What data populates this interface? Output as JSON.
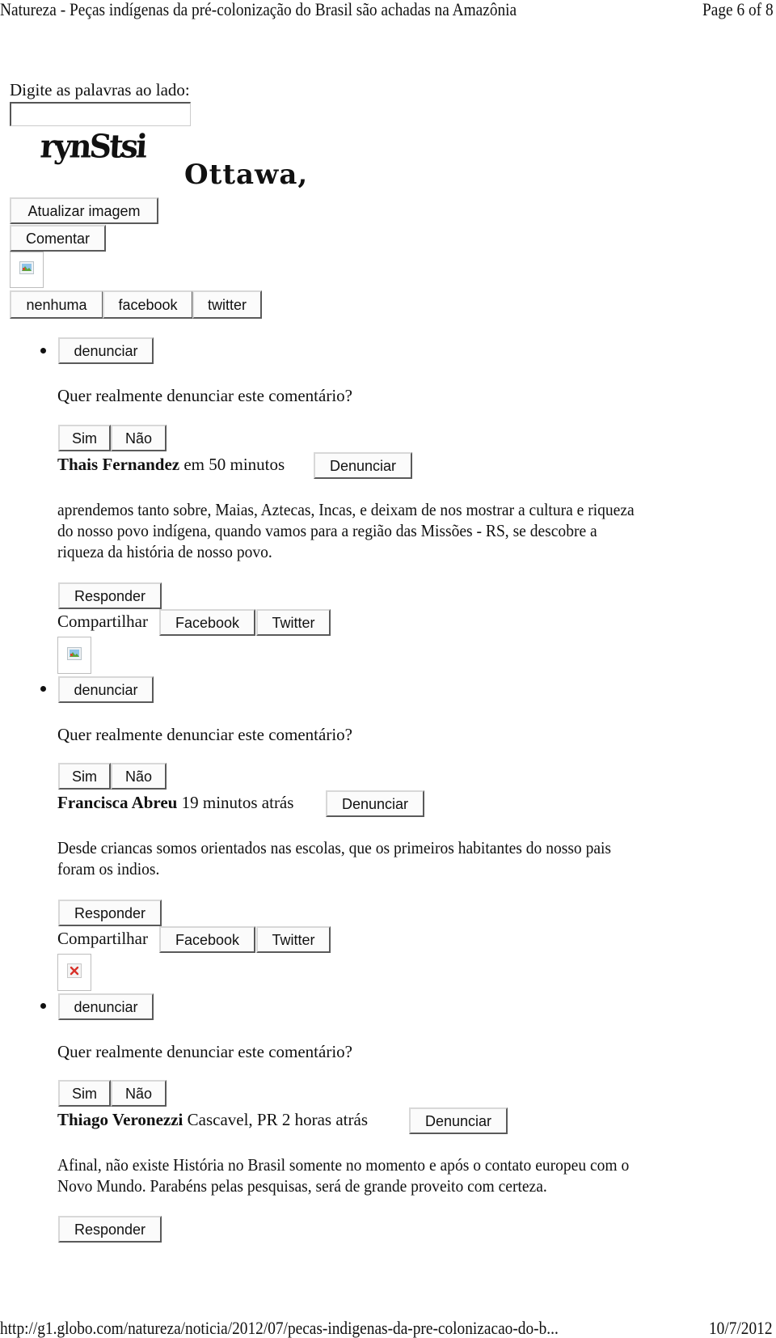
{
  "header": {
    "title": "Natureza - Peças indígenas da pré-colonização do Brasil são achadas na Amazônia",
    "page": "Page 6 of 8"
  },
  "captcha": {
    "label": "Digite as palavras ao lado:",
    "input_value": "",
    "word1": "rynStsi",
    "word2": "Ottawa,",
    "refresh_label": "Atualizar imagem",
    "submit_label": "Comentar"
  },
  "share_options": [
    "nenhuma",
    "facebook",
    "twitter"
  ],
  "icons": {
    "image_placeholder": "broken-image-icon",
    "image_error": "image-error-x-icon"
  },
  "report_prompt": {
    "report_label": "denunciar",
    "question": "Quer realmente denunciar este comentário?",
    "yes": "Sim",
    "no": "Não"
  },
  "comments": [
    {
      "author": "Thais Fernandez",
      "meta": " em 50 minutos",
      "report_label": "Denunciar",
      "text_lines": [
        "aprendemos tanto sobre, Maias, Aztecas, Incas, e deixam de nos mostrar a cultura e riqueza",
        "do nosso povo indígena, quando vamos para a região das Missões - RS, se descobre a",
        "riqueza da história de nosso povo."
      ],
      "reply_label": "Responder",
      "share_label": "Compartilhar",
      "share_facebook": "Facebook",
      "share_twitter": "Twitter"
    },
    {
      "author": "Francisca Abreu",
      "meta": " 19 minutos atrás",
      "report_label": "Denunciar",
      "text_lines": [
        "Desde criancas somos orientados nas escolas, que os primeiros habitantes do nosso pais",
        "foram os indios."
      ],
      "reply_label": "Responder",
      "share_label": "Compartilhar",
      "share_facebook": "Facebook",
      "share_twitter": "Twitter"
    },
    {
      "author": "Thiago Veronezzi",
      "meta": " Cascavel, PR 2 horas atrás",
      "report_label": "Denunciar",
      "text_lines": [
        "Afinal, não existe História no Brasil somente no momento e após o contato europeu com o",
        "Novo Mundo. Parabéns pelas pesquisas, será de grande proveito com certeza."
      ],
      "reply_label": "Responder"
    }
  ],
  "footer": {
    "url": "http://g1.globo.com/natureza/noticia/2012/07/pecas-indigenas-da-pre-colonizacao-do-b...",
    "date": "10/7/2012"
  }
}
